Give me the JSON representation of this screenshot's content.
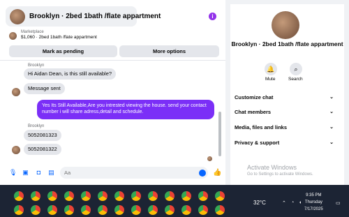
{
  "conversation": {
    "title": "Brooklyn · 2bed 1bath /flate appartment",
    "info_icon": "info-icon"
  },
  "marketplace": {
    "label": "Marketplace",
    "item": "$1,060 · 2bed 1bath /flate appartment"
  },
  "actions": {
    "mark_pending": "Mark as pending",
    "more_options": "More options"
  },
  "messages": [
    {
      "sender": "Brooklyn",
      "text": "Hi Aidan Dean, is this still available?"
    },
    {
      "text": "Message sent"
    },
    {
      "outgoing": true,
      "text": "Yes Its Still Available,Are you intrested viewing the house. send your contact number i will share adress,detail and schedule."
    },
    {
      "sender": "Brooklyn",
      "text": "5052081323"
    },
    {
      "text": "5052081322"
    }
  ],
  "composer": {
    "placeholder": "Aa",
    "icons": [
      "mic-icon",
      "image-icon",
      "sticker-icon",
      "gif-icon",
      "emoji-icon",
      "thumbs-up-icon"
    ]
  },
  "details": {
    "title": "Brooklyn · 2bed 1bath /flate appartment",
    "mute": "Mute",
    "search": "Search",
    "sections": [
      "Customize chat",
      "Chat members",
      "Media, files and links",
      "Privacy & support"
    ]
  },
  "watermark": {
    "title": "Activate Windows",
    "subtitle": "Go to Settings to activate Windows."
  },
  "taskbar": {
    "weather": "32°C",
    "time": "9:35 PM",
    "day": "Thursday",
    "date": "7/17/2025"
  },
  "colors": {
    "accent": "#7b2ff7",
    "messenger_blue": "#0866ff"
  }
}
